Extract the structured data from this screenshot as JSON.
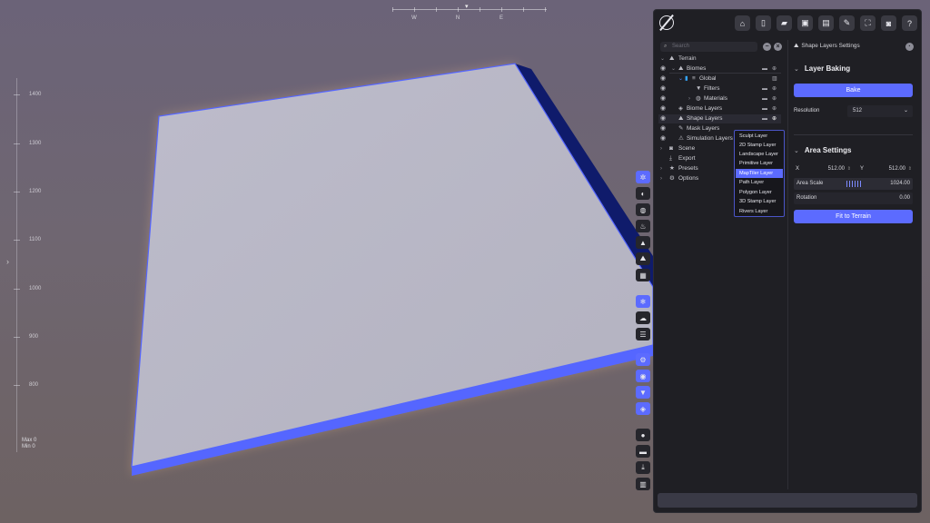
{
  "viewport": {
    "compass": {
      "labels": [
        "W",
        "N",
        "E"
      ],
      "marker": "▾"
    },
    "ruler": {
      "labels": [
        "1400",
        "1300",
        "1200",
        "1100",
        "1000",
        "900",
        "800"
      ],
      "max": "Max 0",
      "min": "Min 0"
    },
    "left_chevron": "›"
  },
  "toolbar": {
    "icons": [
      "settings-gear-icon",
      "contrast-icon",
      "globe-icon",
      "fire-icon",
      "mountain-icon",
      "terrain-icon",
      "grid-icon",
      "snowflake-icon",
      "weather-icon",
      "list-icon",
      "gear-cog-icon",
      "eye-icon",
      "filter-icon",
      "layers-icon",
      "settings-icon",
      "folder-icon",
      "download-icon",
      "chart-icon"
    ]
  },
  "topbar": {
    "icons": [
      "home-icon",
      "new-file-icon",
      "open-folder-icon",
      "save-icon",
      "save-as-icon",
      "export-icon",
      "fullscreen-icon",
      "camera-icon",
      "help-icon"
    ]
  },
  "layers": {
    "search_placeholder": "Search",
    "items": [
      {
        "label": "Terrain"
      },
      {
        "label": "Biomes"
      },
      {
        "label": "Global"
      },
      {
        "label": "Filters"
      },
      {
        "label": "Materials"
      },
      {
        "label": "Biome Layers"
      },
      {
        "label": "Shape Layers"
      },
      {
        "label": "Mask Layers"
      },
      {
        "label": "Simulation Layers"
      },
      {
        "label": "Scene"
      },
      {
        "label": "Export"
      },
      {
        "label": "Presets"
      },
      {
        "label": "Options"
      }
    ]
  },
  "context_menu": {
    "items": [
      "Sculpt Layer",
      "2D Stamp Layer",
      "Landscape Layer",
      "Primitive Layer",
      "MapTiler Layer",
      "Path Layer",
      "Polygon Layer",
      "3D Stamp Layer",
      "Rivers Layer"
    ],
    "highlighted": "MapTiler Layer"
  },
  "settings": {
    "title": "Shape Layers Settings",
    "layer_baking": {
      "heading": "Layer Baking",
      "bake_label": "Bake",
      "resolution_label": "Resolution",
      "resolution_value": "512"
    },
    "area_settings": {
      "heading": "Area Settings",
      "x_label": "X",
      "x_value": "512.00",
      "y_label": "Y",
      "y_value": "512.00",
      "area_scale_label": "Area Scale",
      "area_scale_value": "1024.00",
      "rotation_label": "Rotation",
      "rotation_value": "0.00",
      "fit_label": "Fit to Terrain"
    }
  },
  "colors": {
    "accent": "#5c6bff",
    "panel": "#1f1f24",
    "terrain_top": "#b9b8c6",
    "terrain_edge": "#5566ff"
  }
}
